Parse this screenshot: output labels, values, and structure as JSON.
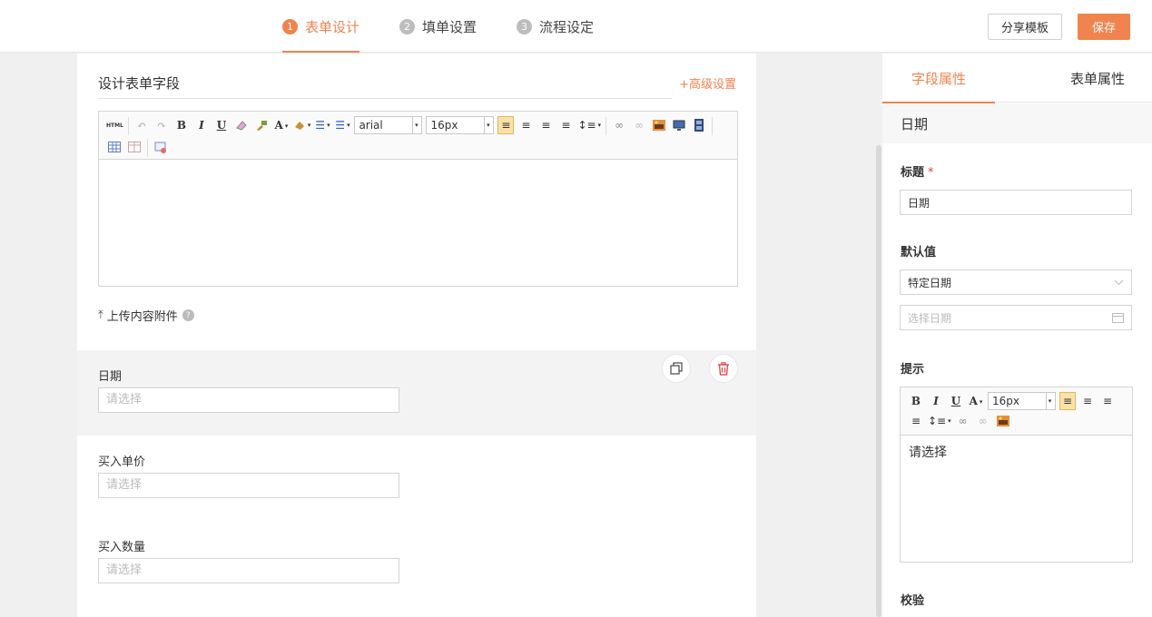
{
  "steps": [
    {
      "num": "1",
      "label": "表单设计"
    },
    {
      "num": "2",
      "label": "填单设置"
    },
    {
      "num": "3",
      "label": "流程设定"
    }
  ],
  "header": {
    "share_label": "分享模板",
    "save_label": "保存"
  },
  "canvas": {
    "section_title": "设计表单字段",
    "advanced_link": "+高级设置",
    "editor": {
      "font": "arial",
      "size": "16px",
      "html_label": "HTML"
    },
    "upload_label": "上传内容附件",
    "fields": [
      {
        "label": "日期",
        "placeholder": "请选择"
      },
      {
        "label": "买入单价",
        "placeholder": "请选择"
      },
      {
        "label": "买入数量",
        "placeholder": "请选择"
      }
    ]
  },
  "panel": {
    "tab_field": "字段属性",
    "tab_form": "表单属性",
    "field_type": "日期",
    "title_label": "标题",
    "required_mark": "*",
    "title_value": "日期",
    "default_label": "默认值",
    "default_select": "特定日期",
    "date_placeholder": "选择日期",
    "hint_label": "提示",
    "hint_size": "16px",
    "hint_text": "请选择",
    "validate_label": "校验"
  },
  "colors": {
    "accent": "#f0834e",
    "danger": "#e03e3e"
  }
}
